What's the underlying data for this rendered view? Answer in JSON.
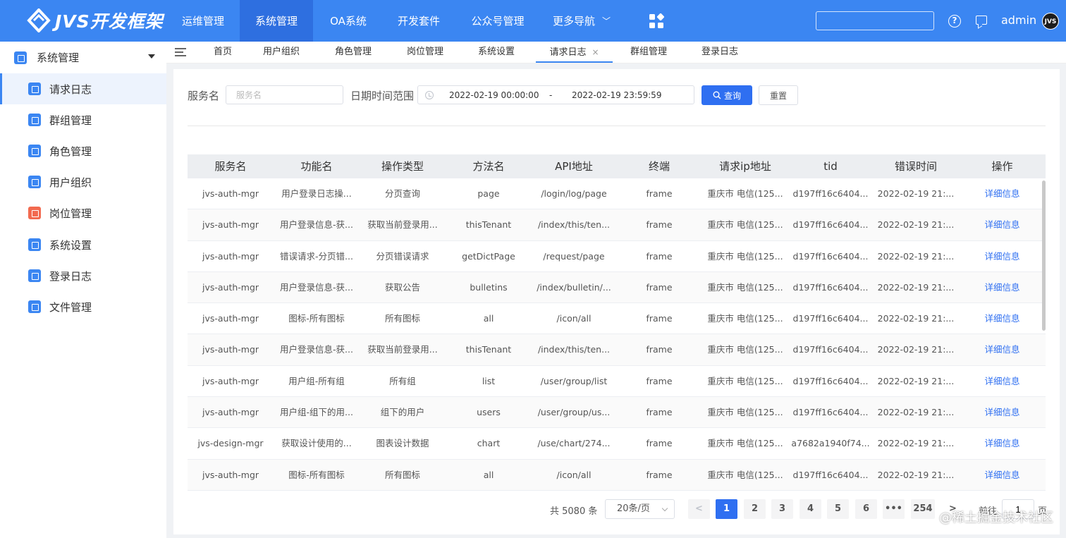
{
  "brand": {
    "name": "JVS开发框架"
  },
  "nav": {
    "items": [
      {
        "label": "运维管理"
      },
      {
        "label": "系统管理"
      },
      {
        "label": "OA系统"
      },
      {
        "label": "开发套件"
      },
      {
        "label": "公众号管理"
      },
      {
        "label": "更多导航"
      }
    ],
    "active_index": 1
  },
  "header": {
    "username": "admin",
    "avatar_text": "JVS",
    "search_value": ""
  },
  "sidebar": {
    "group_label": "系统管理",
    "items": [
      {
        "label": "请求日志",
        "icon_color": "#3b86f2"
      },
      {
        "label": "群组管理",
        "icon_color": "#3b86f2"
      },
      {
        "label": "角色管理",
        "icon_color": "#3b86f2"
      },
      {
        "label": "用户组织",
        "icon_color": "#3b86f2"
      },
      {
        "label": "岗位管理",
        "icon_color": "#f26a4f"
      },
      {
        "label": "系统设置",
        "icon_color": "#3b86f2"
      },
      {
        "label": "登录日志",
        "icon_color": "#3b86f2"
      },
      {
        "label": "文件管理",
        "icon_color": "#3b86f2"
      }
    ]
  },
  "tabs": [
    {
      "label": "首页"
    },
    {
      "label": "用户组织"
    },
    {
      "label": "角色管理"
    },
    {
      "label": "岗位管理"
    },
    {
      "label": "系统设置"
    },
    {
      "label": "请求日志",
      "close": "×"
    },
    {
      "label": "群组管理"
    },
    {
      "label": "登录日志"
    }
  ],
  "filters": {
    "service_label": "服务名",
    "service_placeholder": "服务名",
    "daterange_label": "日期时间范围",
    "start": "2022-02-19 00:00:00",
    "sep": "-",
    "end": "2022-02-19 23:59:59",
    "query_label": "查询",
    "reset_label": "重置"
  },
  "table": {
    "columns": [
      "服务名",
      "功能名",
      "操作类型",
      "方法名",
      "API地址",
      "终端",
      "请求ip地址",
      "tid",
      "错误时间",
      "操作"
    ],
    "action_label": "详细信息",
    "rows": [
      [
        "jvs-auth-mgr",
        "用户登录日志操...",
        "分页查询",
        "page",
        "/login/log/page",
        "frame",
        "重庆市 电信(125...",
        "d197ff16c6404...",
        "2022-02-19 21:..."
      ],
      [
        "jvs-auth-mgr",
        "用户登录信息-获...",
        "获取当前登录用...",
        "thisTenant",
        "/index/this/ten...",
        "frame",
        "重庆市 电信(125...",
        "d197ff16c6404...",
        "2022-02-19 21:..."
      ],
      [
        "jvs-auth-mgr",
        "错误请求-分页错...",
        "分页错误请求",
        "getDictPage",
        "/request/page",
        "frame",
        "重庆市 电信(125...",
        "d197ff16c6404...",
        "2022-02-19 21:..."
      ],
      [
        "jvs-auth-mgr",
        "用户登录信息-获...",
        "获取公告",
        "bulletins",
        "/index/bulletin/...",
        "frame",
        "重庆市 电信(125...",
        "d197ff16c6404...",
        "2022-02-19 21:..."
      ],
      [
        "jvs-auth-mgr",
        "图标-所有图标",
        "所有图标",
        "all",
        "/icon/all",
        "frame",
        "重庆市 电信(125...",
        "d197ff16c6404...",
        "2022-02-19 21:..."
      ],
      [
        "jvs-auth-mgr",
        "用户登录信息-获...",
        "获取当前登录用...",
        "thisTenant",
        "/index/this/ten...",
        "frame",
        "重庆市 电信(125...",
        "d197ff16c6404...",
        "2022-02-19 21:..."
      ],
      [
        "jvs-auth-mgr",
        "用户组-所有组",
        "所有组",
        "list",
        "/user/group/list",
        "frame",
        "重庆市 电信(125...",
        "d197ff16c6404...",
        "2022-02-19 21:..."
      ],
      [
        "jvs-auth-mgr",
        "用户组-组下的用...",
        "组下的用户",
        "users",
        "/user/group/us...",
        "frame",
        "重庆市 电信(125...",
        "d197ff16c6404...",
        "2022-02-19 21:..."
      ],
      [
        "jvs-design-mgr",
        "获取设计使用的...",
        "图表设计数据",
        "chart",
        "/use/chart/274...",
        "frame",
        "重庆市 电信(125...",
        "a7682a1940f74...",
        "2022-02-19 21:..."
      ],
      [
        "jvs-auth-mgr",
        "图标-所有图标",
        "所有图标",
        "all",
        "/icon/all",
        "frame",
        "重庆市 电信(125...",
        "d197ff16c6404...",
        "2022-02-19 21:..."
      ]
    ]
  },
  "pagination": {
    "total_text": "共 5080 条",
    "page_size": "20条/页",
    "prev": "<",
    "pages": [
      "1",
      "2",
      "3",
      "4",
      "5",
      "6",
      "•••",
      "254"
    ],
    "next": ">",
    "current": "1",
    "jump_label": "前往",
    "jump_value": "1",
    "jump_suffix": "页"
  },
  "watermark": "@稀土掘金技术社区",
  "colors": {
    "primary": "#3b86f2",
    "primary_dark": "#2e6fe0",
    "button": "#2f6ff1",
    "accent_orange": "#f26a4f"
  }
}
